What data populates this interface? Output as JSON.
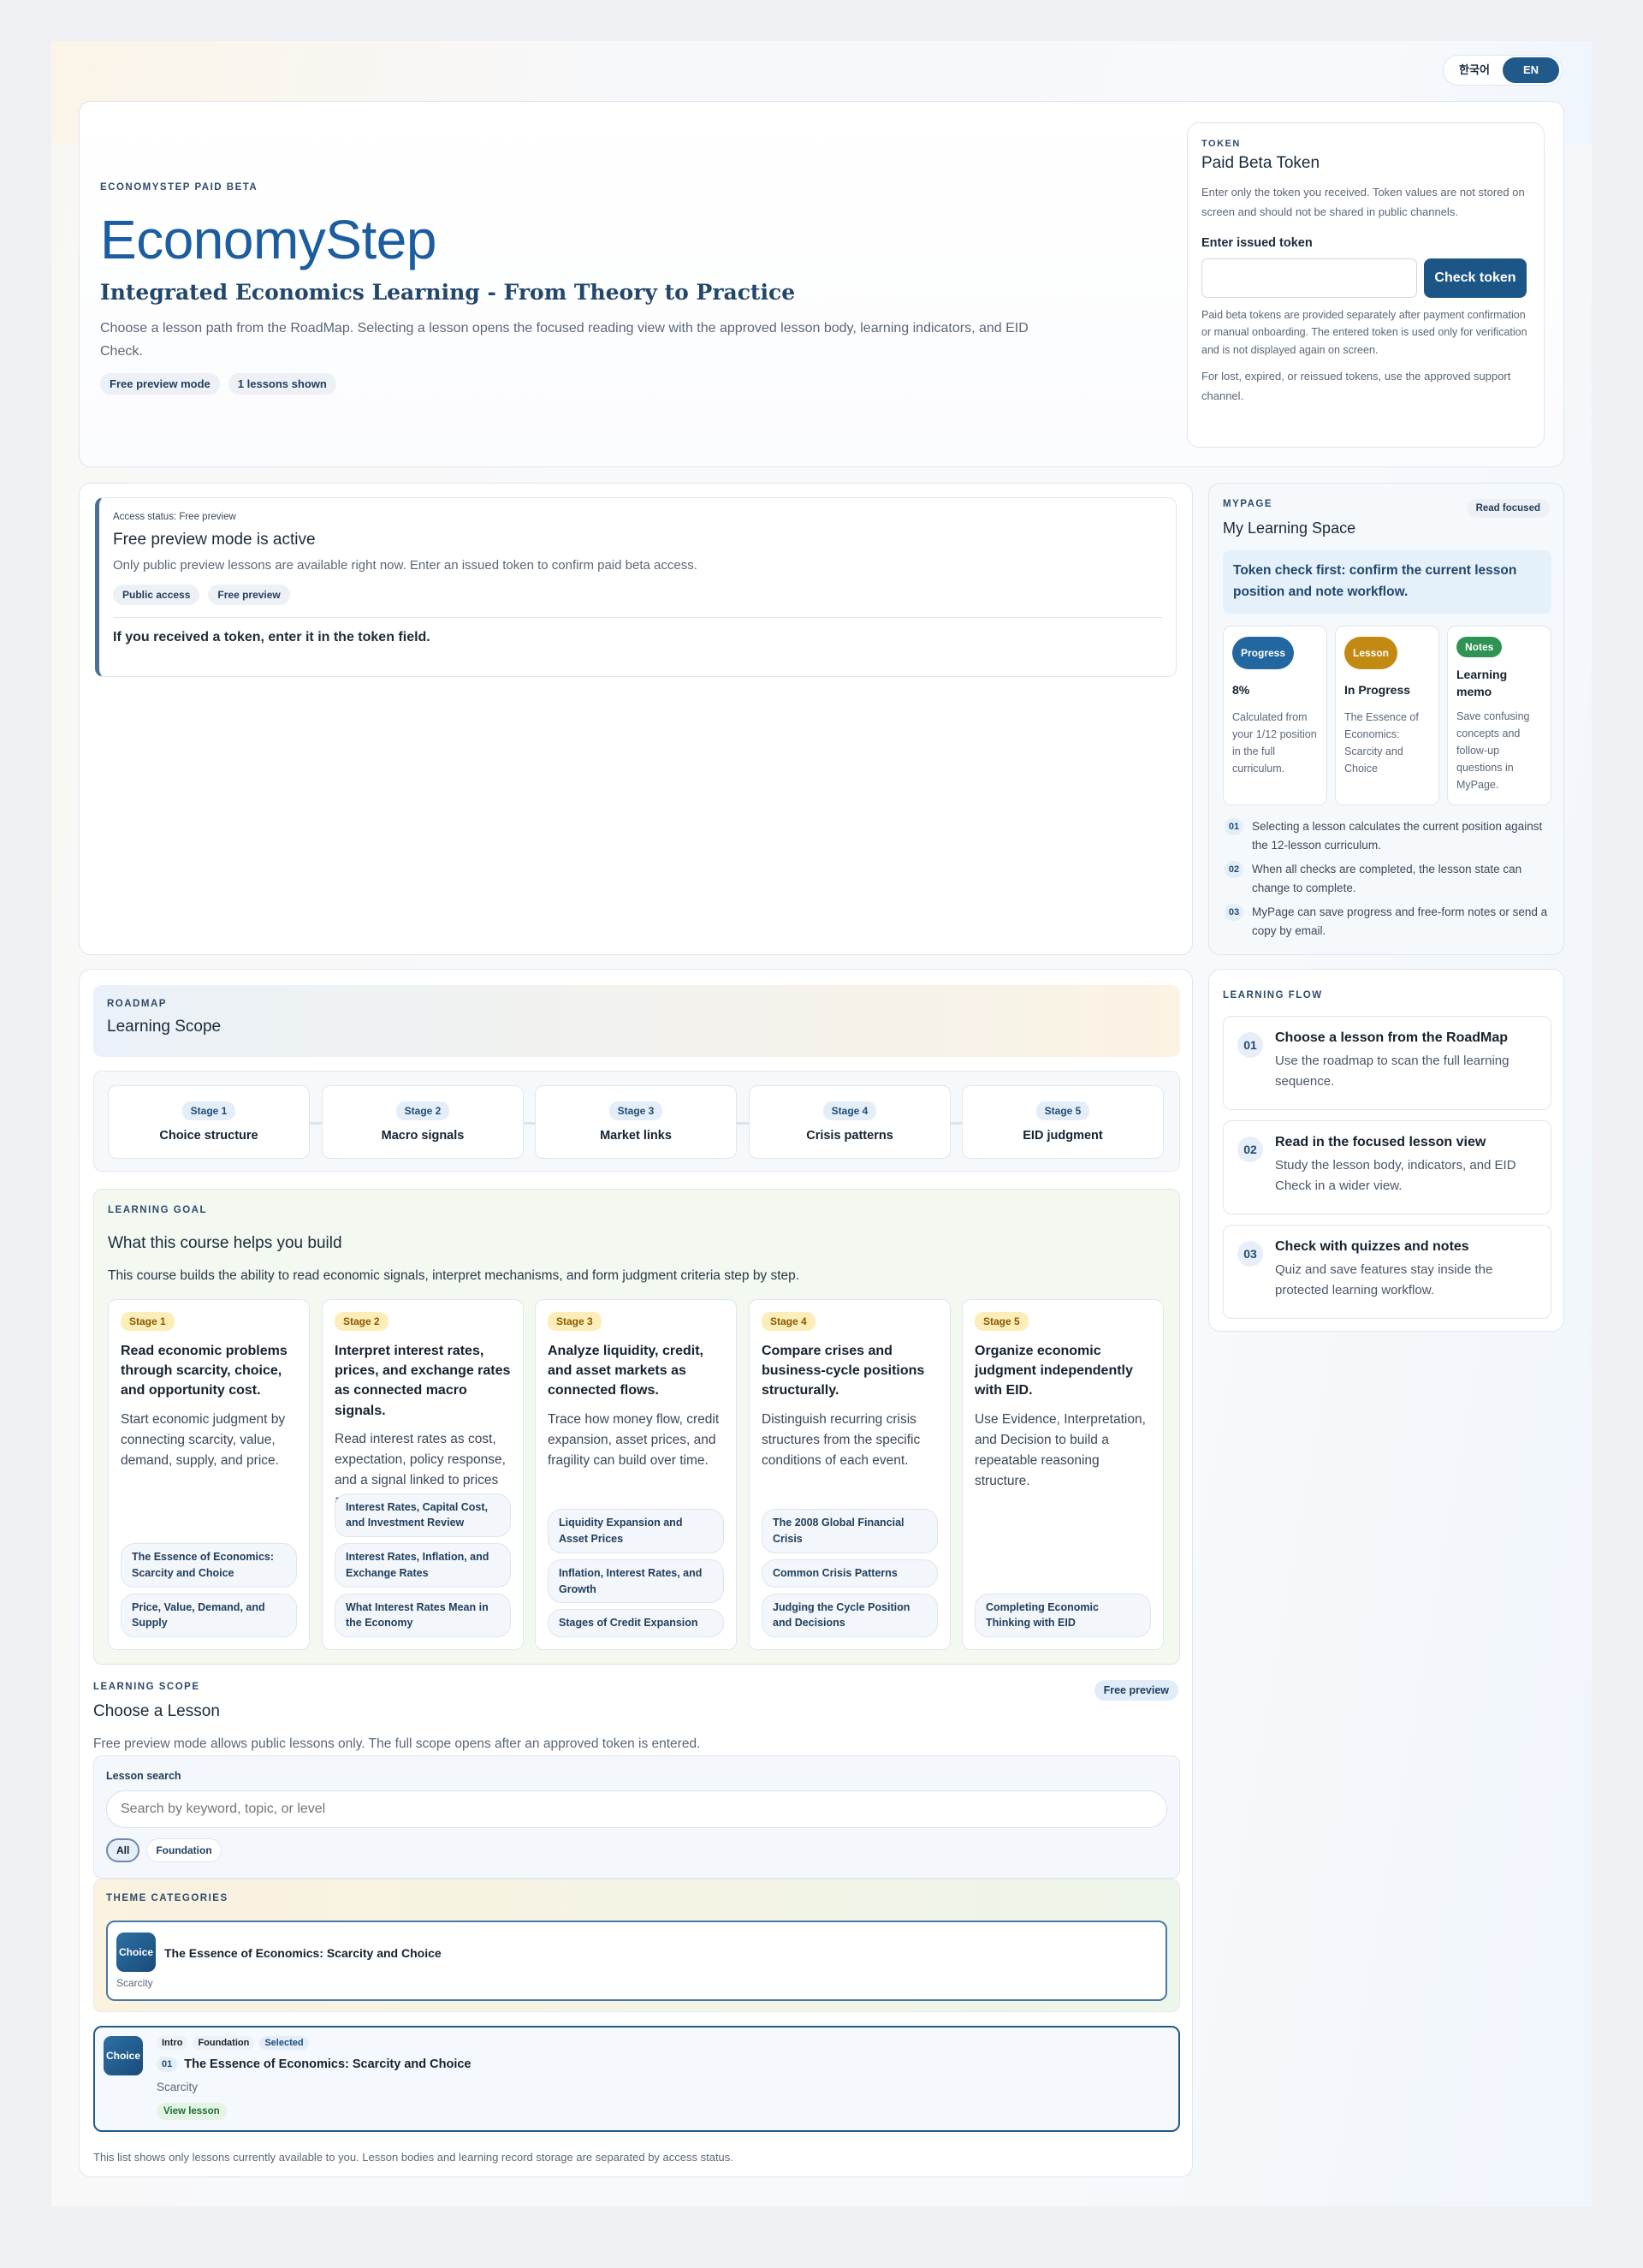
{
  "lang_toggle": {
    "ko": "한국어",
    "en": "EN"
  },
  "hero": {
    "eyebrow": "ECONOMYSTEP PAID BETA",
    "title": "EconomyStep",
    "subtitle": "Integrated Economics Learning - From Theory to Practice",
    "description": "Choose a lesson path from the RoadMap. Selecting a lesson opens the focused reading view with the approved lesson body, learning indicators, and EID Check.",
    "pills": [
      "Free preview mode",
      "1 lessons shown"
    ]
  },
  "token": {
    "eyebrow": "TOKEN",
    "title": "Paid Beta Token",
    "description": "Enter only the token you received. Token values are not stored on screen and should not be shared in public channels.",
    "input_label": "Enter issued token",
    "input_value": "",
    "button": "Check token",
    "note1": "Paid beta tokens are provided separately after payment confirmation or manual onboarding. The entered token is used only for verification and is not displayed again on screen.",
    "note2": "For lost, expired, or reissued tokens, use the approved support channel."
  },
  "access": {
    "status": "Access status: Free preview",
    "title": "Free preview mode is active",
    "text": "Only public preview lessons are available right now. Enter an issued token to confirm paid beta access.",
    "pills": [
      "Public access",
      "Free preview"
    ],
    "hint": "If you received a token, enter it in the token field."
  },
  "mypage": {
    "eyebrow": "MYPAGE",
    "badge": "Read focused",
    "title": "My Learning Space",
    "callout": "Token check first: confirm the current lesson position and note workflow.",
    "cards": [
      {
        "badge": "Progress",
        "color": "#2267a0",
        "value": "8%",
        "text": "Calculated from your 1/12 position in the full curriculum."
      },
      {
        "badge": "Lesson",
        "color": "#c28a12",
        "value": "In Progress",
        "text": "The Essence of Economics: Scarcity and Choice"
      },
      {
        "badge": "Notes",
        "color": "#2f9453",
        "value": "Learning memo",
        "text": "Save confusing concepts and follow-up questions in MyPage."
      }
    ],
    "steps": [
      {
        "n": "01",
        "text": "Selecting a lesson calculates the current position against the 12-lesson curriculum."
      },
      {
        "n": "02",
        "text": "When all checks are completed, the lesson state can change to complete."
      },
      {
        "n": "03",
        "text": "MyPage can save progress and free-form notes or send a copy by email."
      }
    ]
  },
  "flow": {
    "eyebrow": "LEARNING FLOW",
    "items": [
      {
        "n": "01",
        "title": "Choose a lesson from the RoadMap",
        "text": "Use the roadmap to scan the full learning sequence."
      },
      {
        "n": "02",
        "title": "Read in the focused lesson view",
        "text": "Study the lesson body, indicators, and EID Check in a wider view."
      },
      {
        "n": "03",
        "title": "Check with quizzes and notes",
        "text": "Quiz and save features stay inside the protected learning workflow."
      }
    ]
  },
  "roadmap": {
    "eyebrow": "ROADMAP",
    "title": "Learning Scope",
    "stages": [
      {
        "label": "Stage 1",
        "name": "Choice structure"
      },
      {
        "label": "Stage 2",
        "name": "Macro signals"
      },
      {
        "label": "Stage 3",
        "name": "Market links"
      },
      {
        "label": "Stage 4",
        "name": "Crisis patterns"
      },
      {
        "label": "Stage 5",
        "name": "EID judgment"
      }
    ]
  },
  "goal": {
    "eyebrow": "LEARNING GOAL",
    "title": "What this course helps you build",
    "text": "This course builds the ability to read economic signals, interpret mechanisms, and form judgment criteria step by step.",
    "cards": [
      {
        "stage": "Stage 1",
        "title": "Read economic problems through scarcity, choice, and opportunity cost.",
        "text": "Start economic judgment by connecting scarcity, value, demand, supply, and price.",
        "chips": [
          "The Essence of Economics: Scarcity and Choice",
          "Price, Value, Demand, and Supply"
        ]
      },
      {
        "stage": "Stage 2",
        "title": "Interpret interest rates, prices, and exchange rates as connected macro signals.",
        "text": "Read interest rates as cost, expectation, policy response, and a signal linked to prices and exchange rates.",
        "chips": [
          "Interest Rates, Capital Cost, and Investment Review",
          "Interest Rates, Inflation, and Exchange Rates",
          "What Interest Rates Mean in the Economy"
        ]
      },
      {
        "stage": "Stage 3",
        "title": "Analyze liquidity, credit, and asset markets as connected flows.",
        "text": "Trace how money flow, credit expansion, asset prices, and fragility can build over time.",
        "chips": [
          "Liquidity Expansion and Asset Prices",
          "Inflation, Interest Rates, and Growth",
          "Stages of Credit Expansion"
        ]
      },
      {
        "stage": "Stage 4",
        "title": "Compare crises and business-cycle positions structurally.",
        "text": "Distinguish recurring crisis structures from the specific conditions of each event.",
        "chips": [
          "The 2008 Global Financial Crisis",
          "Common Crisis Patterns",
          "Judging the Cycle Position and Decisions"
        ]
      },
      {
        "stage": "Stage 5",
        "title": "Organize economic judgment independently with EID.",
        "text": "Use Evidence, Interpretation, and Decision to build a repeatable reasoning structure.",
        "chips": [
          "Completing Economic Thinking with EID"
        ]
      }
    ]
  },
  "scope": {
    "eyebrow": "LEARNING SCOPE",
    "badge": "Free preview",
    "title": "Choose a Lesson",
    "text": "Free preview mode allows public lessons only. The full scope opens after an approved token is entered.",
    "search_label": "Lesson search",
    "search_placeholder": "Search by keyword, topic, or level",
    "filters": [
      "All",
      "Foundation"
    ]
  },
  "themes": {
    "eyebrow": "THEME CATEGORIES",
    "item": {
      "icon": "Choice",
      "title": "The Essence of Economics: Scarcity and Choice",
      "sub": "Scarcity"
    }
  },
  "lesson": {
    "icon": "Choice",
    "tags": [
      "Intro",
      "Foundation",
      "Selected"
    ],
    "num": "01",
    "title": "The Essence of Economics: Scarcity and Choice",
    "sub": "Scarcity",
    "action": "View lesson"
  },
  "footer_note": "This list shows only lessons currently available to you. Lesson bodies and learning record storage are separated by access status."
}
